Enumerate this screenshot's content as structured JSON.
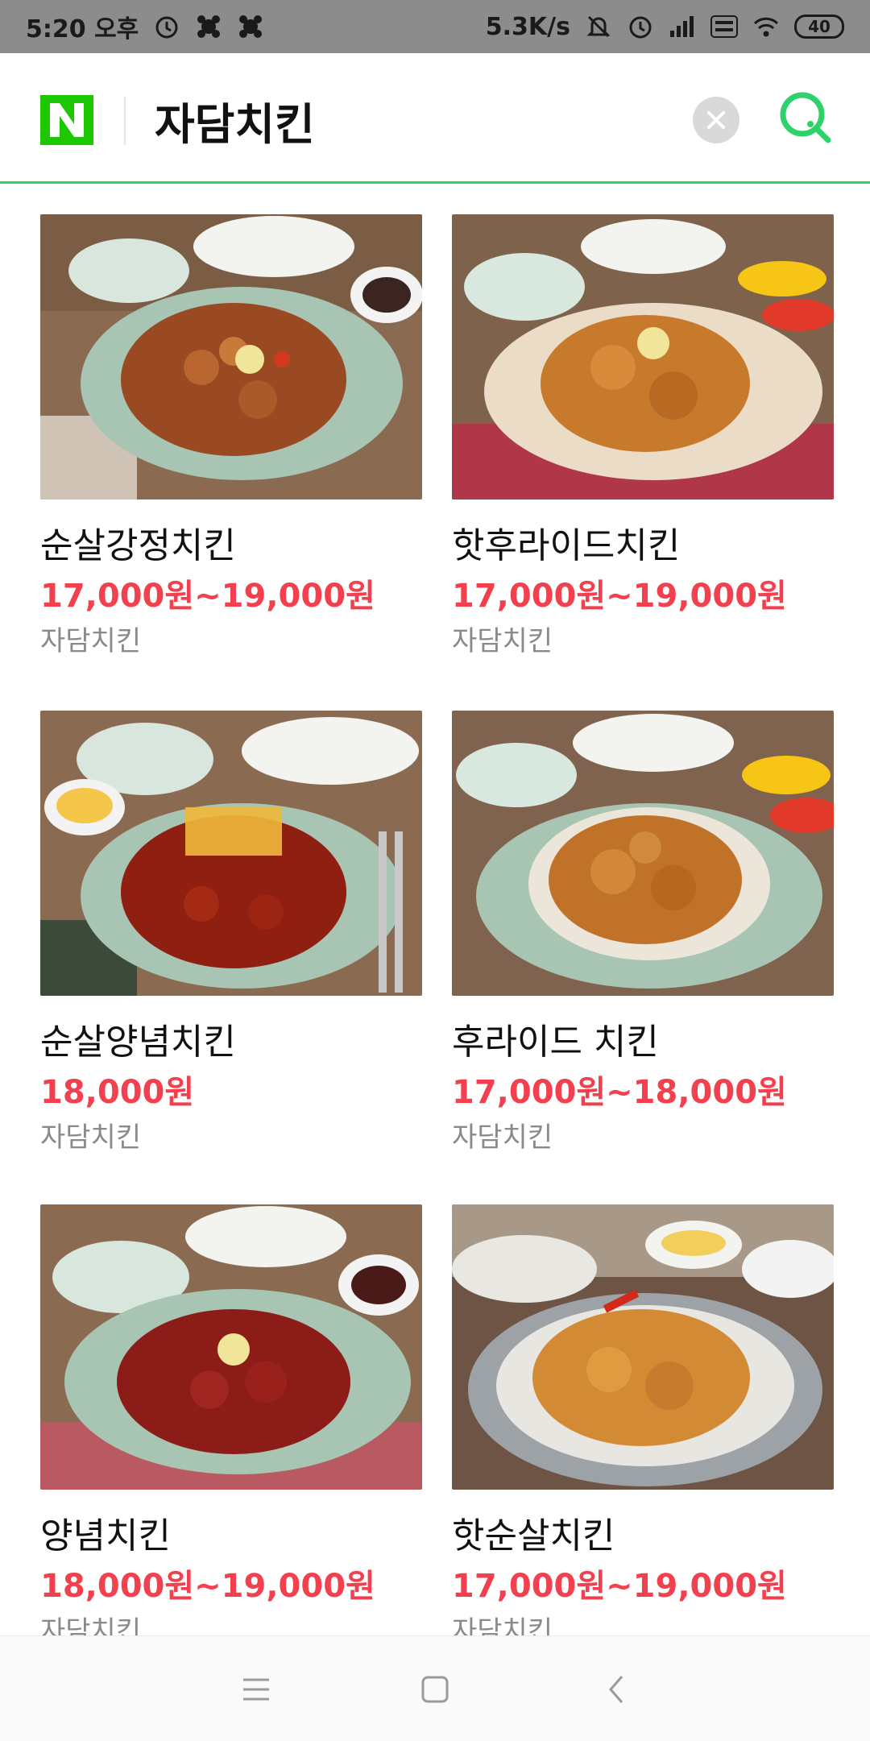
{
  "status_bar": {
    "time": "5:20 오후",
    "network_speed": "5.3K/s",
    "battery": "40",
    "icons": [
      "alarm-icon",
      "app-icon",
      "app-icon",
      "mute-icon",
      "alarm-icon",
      "signal-icon",
      "volte-icon",
      "wifi-icon",
      "battery-icon"
    ]
  },
  "header": {
    "logo": "N",
    "query": "자담치킨",
    "clear_icon": "close-icon",
    "search_icon": "search-icon",
    "accent_color": "#2fd16b"
  },
  "products": [
    {
      "title": "순살강정치킨",
      "price": "17,000원~19,000원",
      "store": "자담치킨"
    },
    {
      "title": "핫후라이드치킨",
      "price": "17,000원~19,000원",
      "store": "자담치킨"
    },
    {
      "title": "순살양념치킨",
      "price": "18,000원",
      "store": "자담치킨"
    },
    {
      "title": "후라이드 치킨",
      "price": "17,000원~18,000원",
      "store": "자담치킨"
    },
    {
      "title": "양념치킨",
      "price": "18,000원~19,000원",
      "store": "자담치킨"
    },
    {
      "title": "핫순살치킨",
      "price": "17,000원~19,000원",
      "store": "자담치킨"
    }
  ],
  "price_color": "#f2404f",
  "nav_bar": {
    "icons": [
      "menu-icon",
      "home-icon",
      "back-icon"
    ]
  }
}
